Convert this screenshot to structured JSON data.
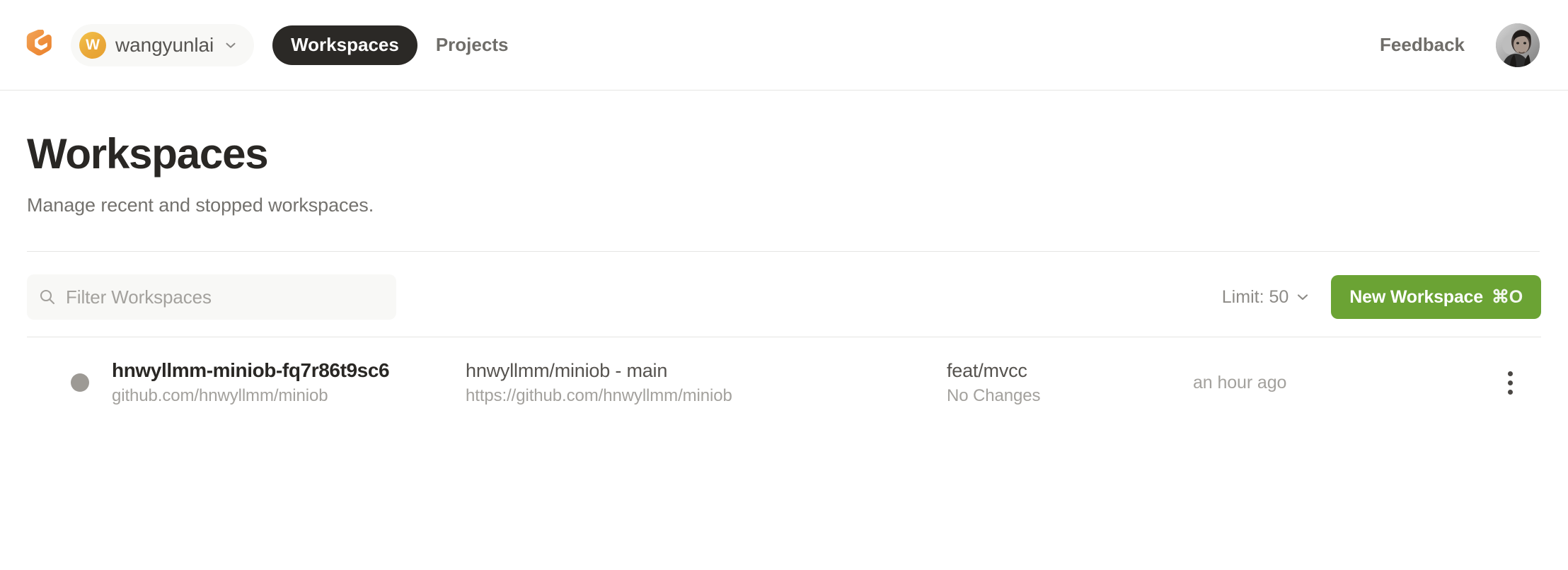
{
  "header": {
    "logo_icon": "gitpod-logo-icon",
    "org": {
      "avatar_initial": "W",
      "name": "wangyunlai",
      "chevron_icon": "chevron-down-icon"
    },
    "nav": [
      {
        "label": "Workspaces",
        "active": true
      },
      {
        "label": "Projects",
        "active": false
      }
    ],
    "feedback_label": "Feedback",
    "user_avatar_icon": "user-avatar"
  },
  "page": {
    "title": "Workspaces",
    "subtitle": "Manage recent and stopped workspaces."
  },
  "toolbar": {
    "filter_placeholder": "Filter Workspaces",
    "filter_value": "",
    "search_icon": "search-icon",
    "limit_label": "Limit: 50",
    "limit_chevron_icon": "chevron-down-icon",
    "new_workspace_label": "New Workspace",
    "new_workspace_shortcut": "⌘O",
    "accent_color": "#6ba334"
  },
  "workspaces": [
    {
      "status": "stopped",
      "status_color": "#9d9a95",
      "name": "hnwyllmm-miniob-fq7r86t9sc6",
      "context_url_short": "github.com/hnwyllmm/miniob",
      "repository": "hnwyllmm/miniob - main",
      "repository_url": "https://github.com/hnwyllmm/miniob",
      "branch": "feat/mvcc",
      "changes": "No Changes",
      "last_active": "an hour ago",
      "menu_icon": "more-vertical-icon"
    }
  ]
}
